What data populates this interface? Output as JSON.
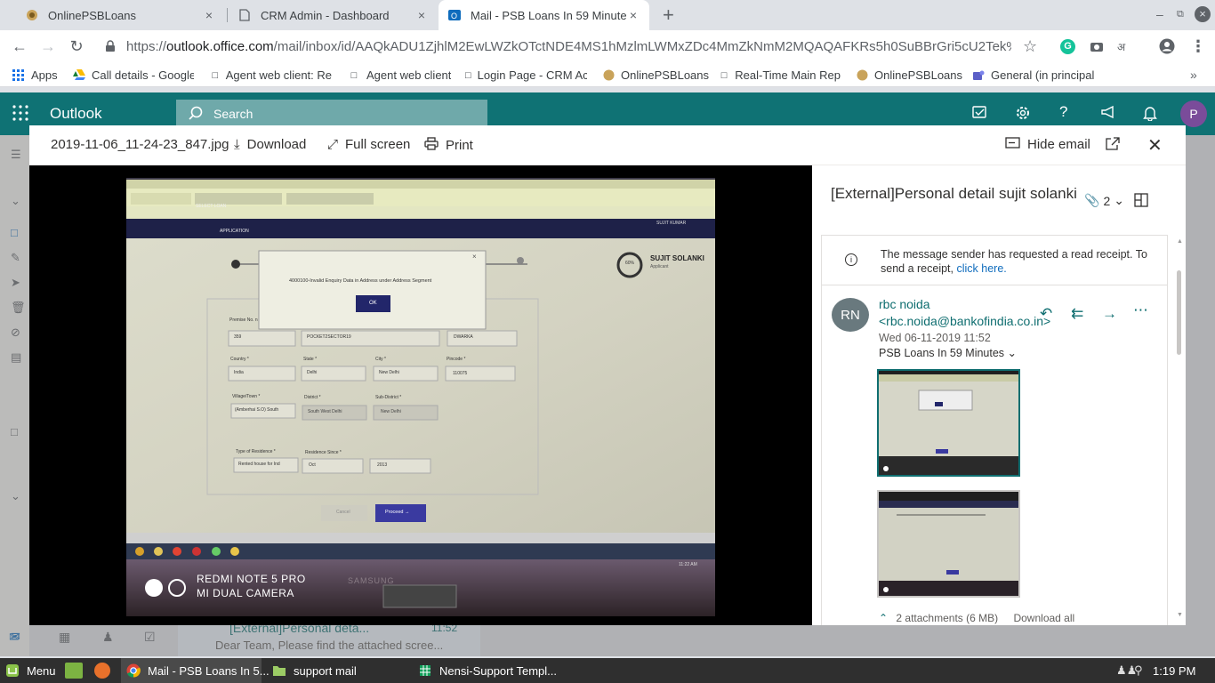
{
  "browser": {
    "tabs": [
      {
        "label": "OnlinePSBLoans",
        "close": "×"
      },
      {
        "label": "CRM Admin - Dashboard",
        "close": "×"
      },
      {
        "label": "Mail - PSB Loans In 59 Minutes",
        "close": "×"
      }
    ],
    "new_tab": "+",
    "url_scheme": "https://",
    "url_host": "outlook.office.com",
    "url_path": "/mail/inbox/id/AAQkADU1ZjhlM2EwLWZkOTctNDE4MS1hMzlmLWMxZDc4MmZkNmM2MQAQAFKRs5h0SuBBrGri5cU2Tek%..."
  },
  "bookmarks": [
    {
      "label": "Apps"
    },
    {
      "label": "Call details - Google"
    },
    {
      "label": "Agent web client: Re"
    },
    {
      "label": "Agent web client"
    },
    {
      "label": "Login Page - CRM Ac"
    },
    {
      "label": "OnlinePSBLoans"
    },
    {
      "label": "Real-Time Main Rep"
    },
    {
      "label": "OnlinePSBLoans"
    },
    {
      "label": "General (in principal"
    }
  ],
  "outlook": {
    "brand": "Outlook",
    "search_placeholder": "Search",
    "avatar_initial": "P"
  },
  "viewer": {
    "filename": "2019-11-06_11-24-23_847.jpg",
    "download": "Download",
    "fullscreen": "Full screen",
    "print": "Print",
    "hide_email": "Hide email"
  },
  "photo": {
    "dialog_text": "4000100-Invalid Enquiry Data in Address under Address Segment",
    "dialog_ok": "OK",
    "applicant_name": "SUJIT SOLANKI",
    "applicant_role": "Applicant",
    "progress": "60%",
    "nav_select_loan": "SELECT LOAN",
    "nav_application": "APPLICATION",
    "user": "SUJIT KUMAR",
    "field_premise_label": "Premise No. n",
    "field_premise": "359",
    "field_street": "POCKET2SECTOR19",
    "field_locality": "DWARKA",
    "country_label": "Country *",
    "country": "India",
    "state_label": "State *",
    "state": "Delhi",
    "city_label": "City *",
    "city": "New Delhi",
    "pincode_label": "Pincode *",
    "pincode": "110075",
    "village_label": "Village/Town *",
    "village": "(Amberhai S.O) South",
    "district_label": "District *",
    "district": "South West Delhi",
    "subdistrict_label": "Sub-District *",
    "subdistrict": "New Delhi",
    "residence_type_label": "Type of Residence *",
    "residence_type": "Rented house for Ind",
    "residence_since_label": "Residence Since *",
    "residence_month": "Oct",
    "residence_year": "2013",
    "cancel": "Cancel",
    "proceed": "Proceed →",
    "watermark_line1": "REDMI NOTE 5 PRO",
    "watermark_line2": "MI DUAL CAMERA",
    "monitor_brand": "SAMSUNG",
    "clock": "11:22 AM"
  },
  "message": {
    "subject": "[External]Personal detail sujit solanki",
    "attachment_count": "2",
    "read_receipt_text": "The message sender has requested a read receipt. To send a receipt,",
    "read_receipt_link": "click here.",
    "avatar_initials": "RN",
    "sender": "rbc noida <rbc.noida@bankofindia.co.in>",
    "date": "Wed 06-11-2019 11:52",
    "to": "PSB Loans In 59 Minutes",
    "attachments_summary": "2 attachments (6 MB)",
    "download_all": "Download all"
  },
  "behind_list": {
    "subject": "[External]Personal deta...",
    "time": "11:52",
    "preview": "Dear Team, Please find the attached scree..."
  },
  "taskbar": {
    "menu": "Menu",
    "items": [
      {
        "label": "Mail - PSB Loans In 5..."
      },
      {
        "label": "support mail"
      },
      {
        "label": "Nensi-Support Templ..."
      }
    ],
    "time": "1:19 PM"
  }
}
